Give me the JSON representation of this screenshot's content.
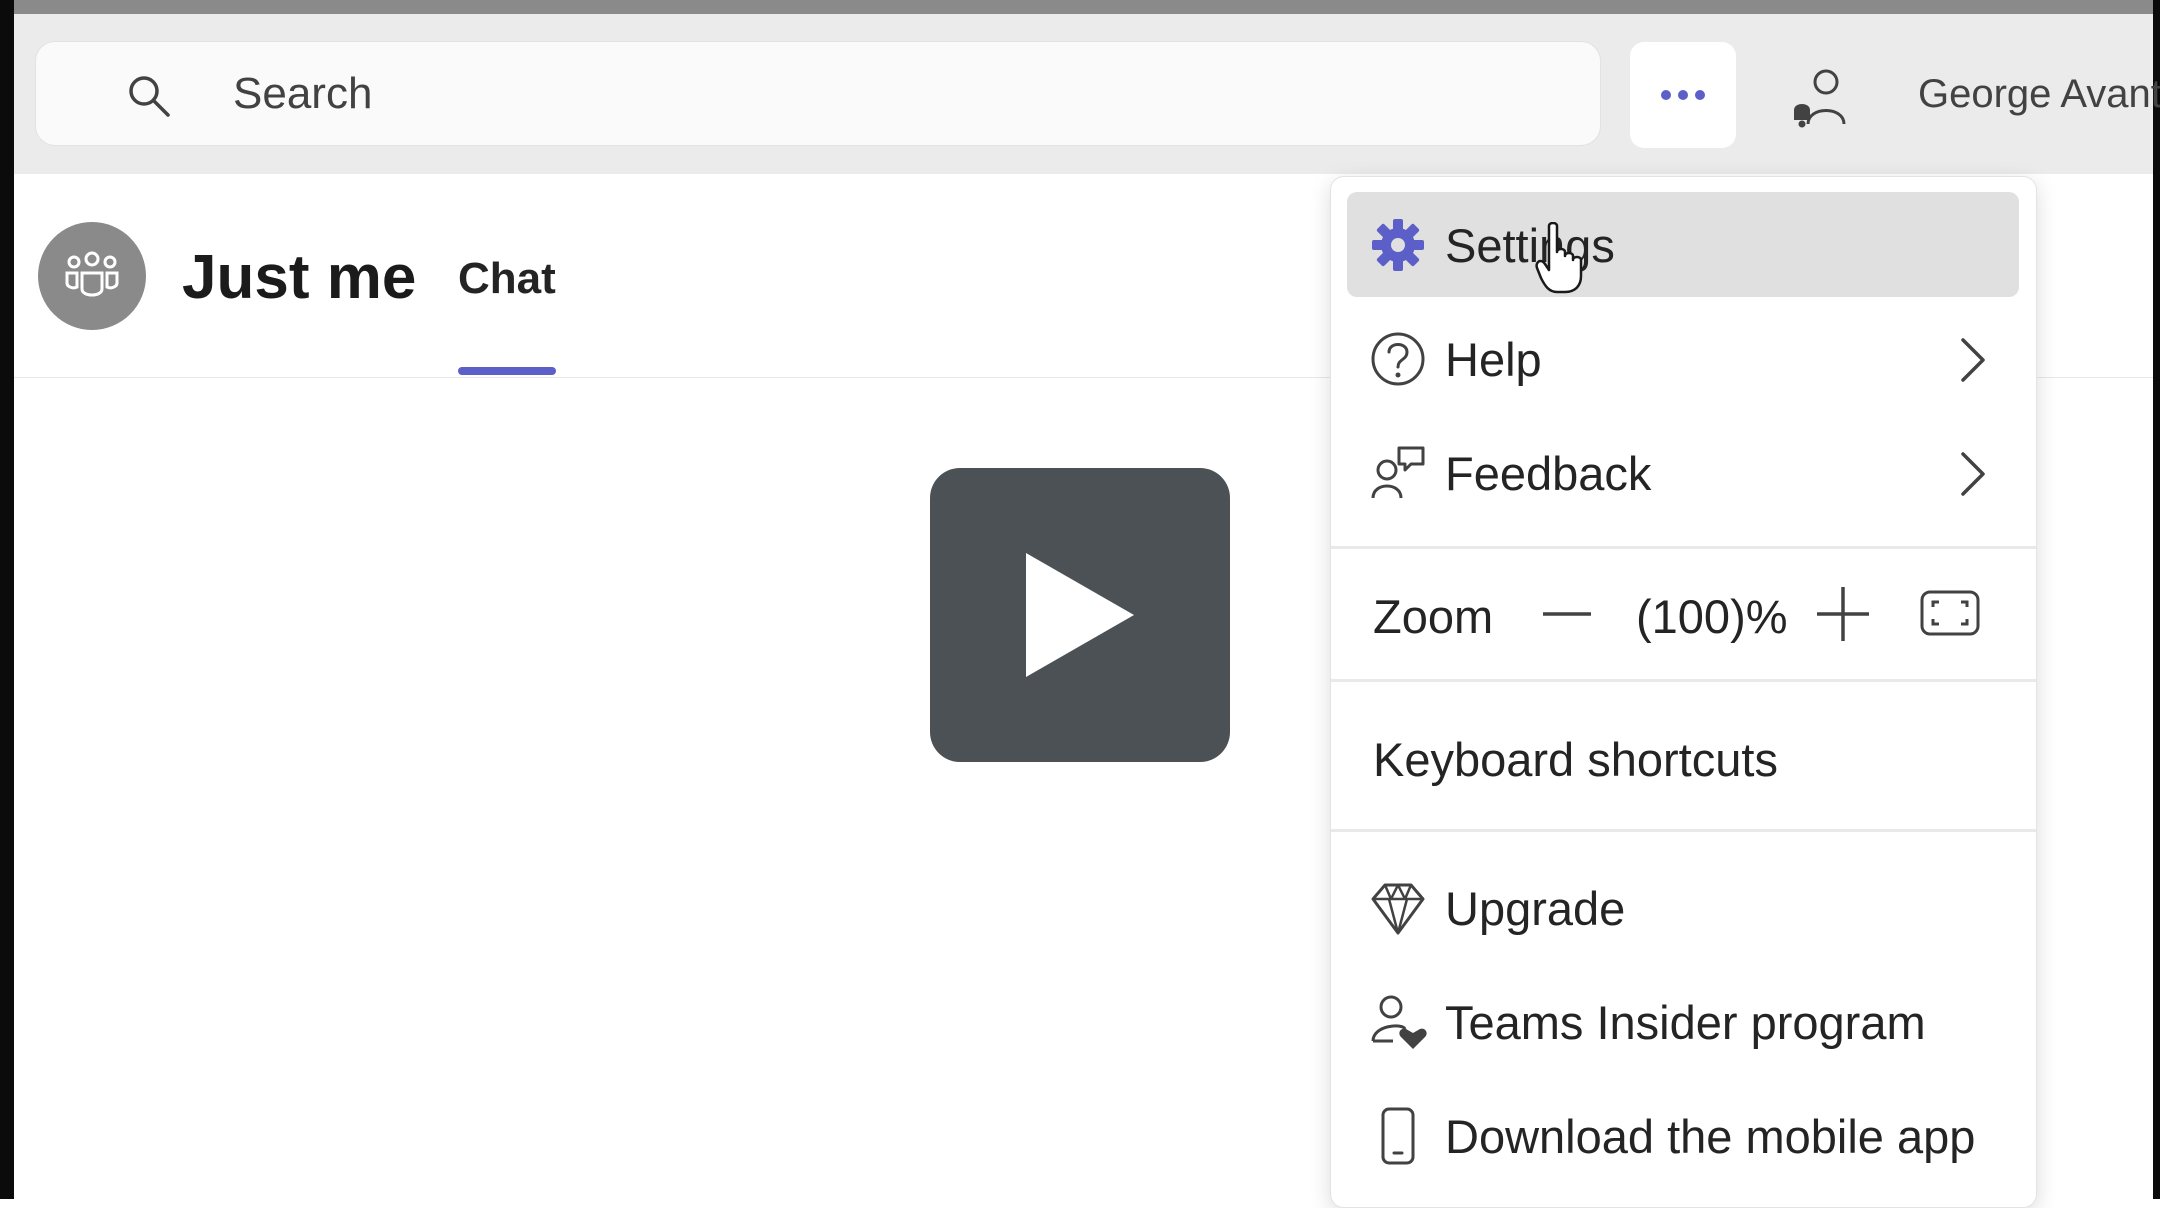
{
  "search": {
    "placeholder": "Search"
  },
  "toolbar": {
    "more_label": "More options",
    "user_name": "George Avant"
  },
  "chat_header": {
    "title": "Just me",
    "tab": "Chat"
  },
  "menu": {
    "items": [
      {
        "label": "Settings",
        "icon": "gear-icon",
        "highlighted": true
      },
      {
        "label": "Help",
        "icon": "question-icon",
        "submenu": true
      },
      {
        "label": "Feedback",
        "icon": "feedback-icon",
        "submenu": true
      }
    ],
    "zoom": {
      "label": "Zoom",
      "value": "(100)%"
    },
    "keyboard_shortcuts": "Keyboard shortcuts",
    "extra_items": [
      {
        "label": "Upgrade",
        "icon": "diamond-icon"
      },
      {
        "label": "Teams Insider program",
        "icon": "insider-icon"
      },
      {
        "label": "Download the mobile app",
        "icon": "phone-icon"
      }
    ]
  },
  "colors": {
    "accent": "#5b5fc7",
    "highlight": "#e0e0e0",
    "video_overlay": "#4b5154"
  }
}
